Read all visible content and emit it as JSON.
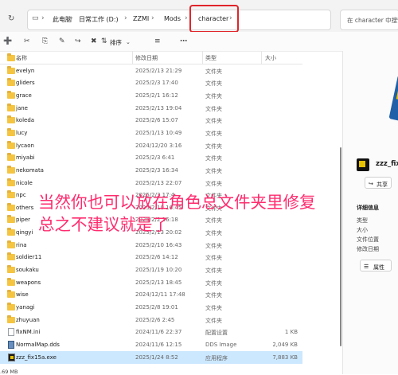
{
  "breadcrumbs": [
    "此电脑",
    "日常工作 (D:)",
    "ZZMI",
    "Mods",
    "character"
  ],
  "search_placeholder": "在 character 中搜索",
  "toolbar": {
    "sort_label": "排序"
  },
  "columns": {
    "name": "名称",
    "date": "修改日期",
    "type": "类型",
    "size": "大小"
  },
  "rows": [
    {
      "name": "...",
      "date": "",
      "type": "",
      "size": ""
    },
    {
      "name": "evelyn",
      "date": "2025/2/13 21:29",
      "type": "文件夹",
      "size": ""
    },
    {
      "name": "gliders",
      "date": "2025/2/3 17:40",
      "type": "文件夹",
      "size": ""
    },
    {
      "name": "grace",
      "date": "2025/2/1 16:12",
      "type": "文件夹",
      "size": ""
    },
    {
      "name": "jane",
      "date": "2025/2/13 19:04",
      "type": "文件夹",
      "size": ""
    },
    {
      "name": "koleda",
      "date": "2025/2/6 15:07",
      "type": "文件夹",
      "size": ""
    },
    {
      "name": "lucy",
      "date": "2025/1/13 10:49",
      "type": "文件夹",
      "size": ""
    },
    {
      "name": "lycaon",
      "date": "2024/12/20 3:16",
      "type": "文件夹",
      "size": ""
    },
    {
      "name": "miyabi",
      "date": "2025/2/3 6:41",
      "type": "文件夹",
      "size": ""
    },
    {
      "name": "nekomata",
      "date": "2025/2/3 16:34",
      "type": "文件夹",
      "size": ""
    },
    {
      "name": "nicole",
      "date": "2025/2/13 22:07",
      "type": "文件夹",
      "size": ""
    },
    {
      "name": "npc",
      "date": "2025/2/3 17:4",
      "type": "文件夹",
      "size": ""
    },
    {
      "name": "others",
      "date": "2025/2/10 16:45",
      "type": "文件夹",
      "size": ""
    },
    {
      "name": "piper",
      "date": "2025/2/2 16:18",
      "type": "文件夹",
      "size": ""
    },
    {
      "name": "qingyi",
      "date": "2025/2/13 20:02",
      "type": "文件夹",
      "size": ""
    },
    {
      "name": "rina",
      "date": "2025/2/10 16:43",
      "type": "文件夹",
      "size": ""
    },
    {
      "name": "soldier11",
      "date": "2025/2/6 14:12",
      "type": "文件夹",
      "size": ""
    },
    {
      "name": "soukaku",
      "date": "2025/1/19 10:20",
      "type": "文件夹",
      "size": ""
    },
    {
      "name": "weapons",
      "date": "2025/2/13 18:45",
      "type": "文件夹",
      "size": ""
    },
    {
      "name": "wise",
      "date": "2024/12/11 17:48",
      "type": "文件夹",
      "size": ""
    },
    {
      "name": "yanagi",
      "date": "2025/2/8 19:01",
      "type": "文件夹",
      "size": ""
    },
    {
      "name": "zhuyuan",
      "date": "2025/2/6 2:45",
      "type": "文件夹",
      "size": ""
    },
    {
      "name": "fixNM.ini",
      "date": "2024/11/6 22:37",
      "type": "配置设置",
      "size": "1 KB"
    },
    {
      "name": "NormalMap.dds",
      "date": "2024/11/6 12:15",
      "type": "DDS Image",
      "size": "2,049 KB"
    },
    {
      "name": "zzz_fix15a.exe",
      "date": "2025/1/24 8:52",
      "type": "应用程序",
      "size": "7,883 KB"
    }
  ],
  "status": ".69 MB",
  "preview": {
    "title": "zzz_fix1",
    "share": "共享",
    "details_header": "详细信息",
    "labels": [
      "类型",
      "大小",
      "文件位置",
      "修改日期"
    ],
    "properties": "属性"
  },
  "overlay": {
    "line1": "当然你也可以放在角色总文件夹里修复",
    "line2": "总之不建议就是了"
  }
}
